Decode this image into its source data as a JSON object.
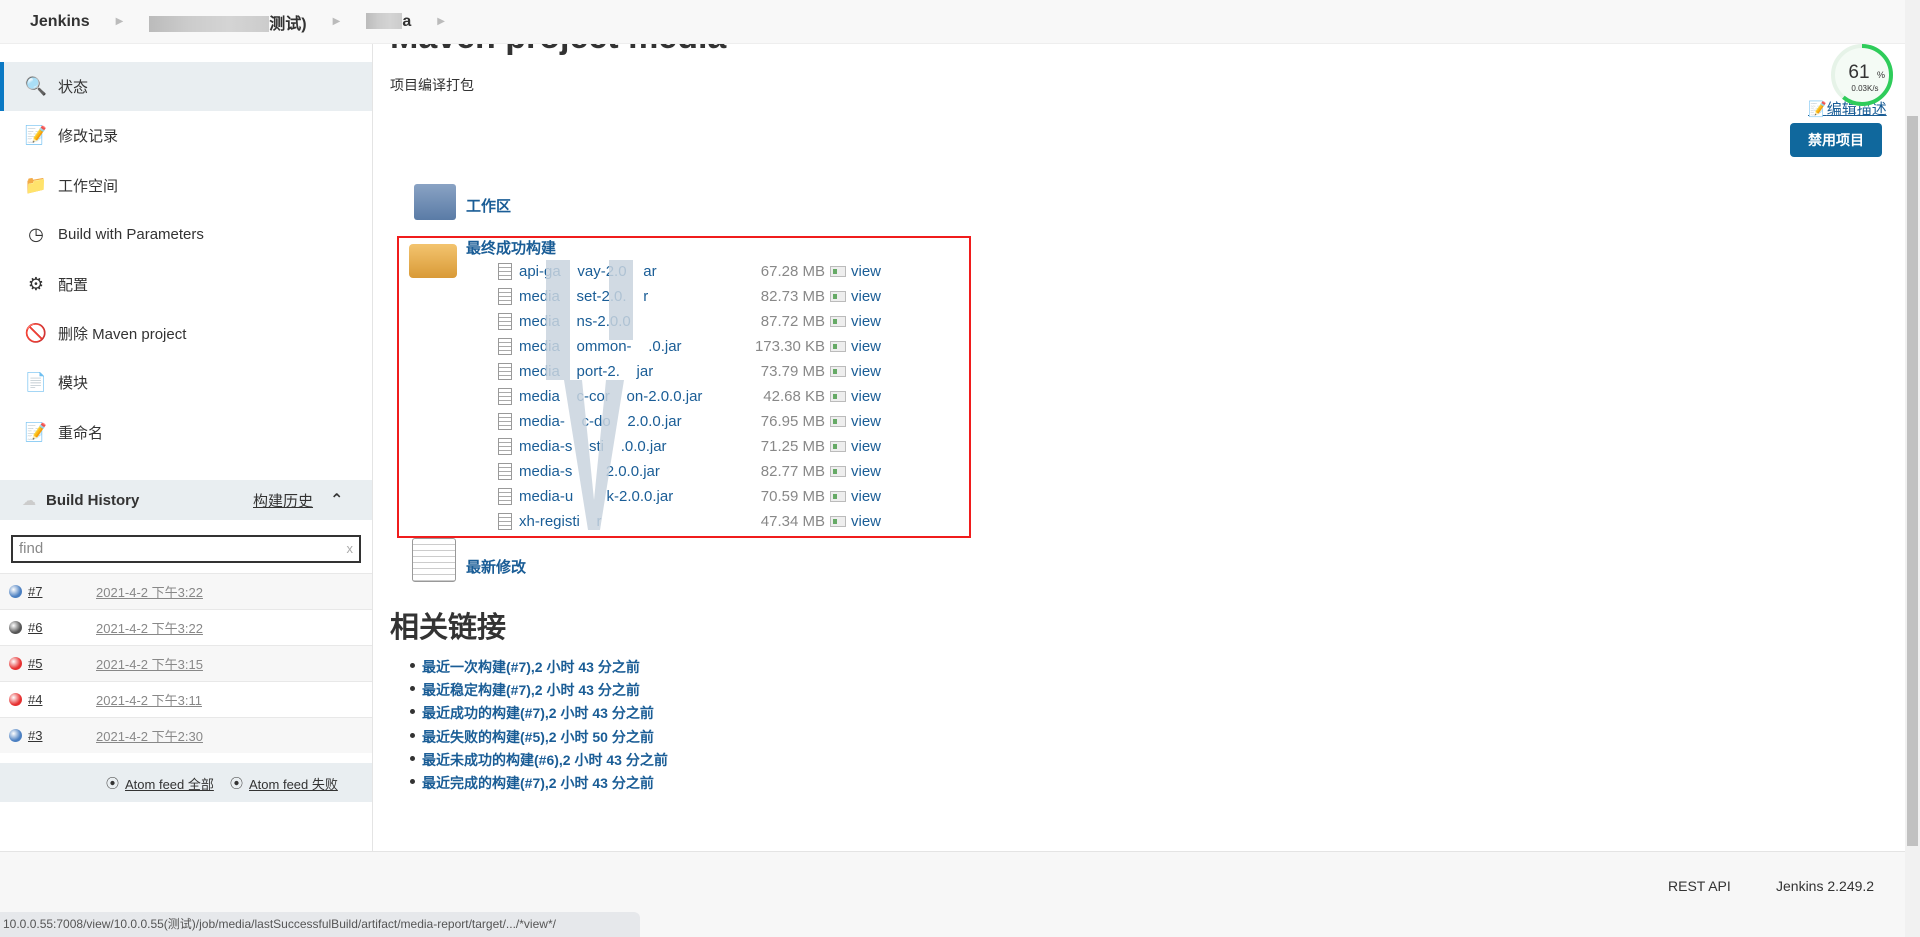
{
  "breadcrumb": {
    "root": "Jenkins",
    "view": "测试)",
    "job": "a"
  },
  "sidebar": {
    "items": [
      {
        "label": "状态",
        "icon": "magnifier-icon",
        "active": true
      },
      {
        "label": "修改记录",
        "icon": "notepad-icon"
      },
      {
        "label": "工作空间",
        "icon": "folder-icon"
      },
      {
        "label": "Build with Parameters",
        "icon": "clock-icon"
      },
      {
        "label": "配置",
        "icon": "gear-icon"
      },
      {
        "label": "删除 Maven project",
        "icon": "no-entry-icon"
      },
      {
        "label": "模块",
        "icon": "document-icon"
      },
      {
        "label": "重命名",
        "icon": "notepad-icon"
      }
    ]
  },
  "build_history": {
    "title": "Build History",
    "link": "构建历史",
    "find_placeholder": "find",
    "clear": "x",
    "builds": [
      {
        "num": "#7",
        "date": "2021-4-2 下午3:22",
        "status": "success",
        "color": "#4a7fc1"
      },
      {
        "num": "#6",
        "date": "2021-4-2 下午3:22",
        "status": "aborted",
        "color": "#555555"
      },
      {
        "num": "#5",
        "date": "2021-4-2 下午3:15",
        "status": "failed",
        "color": "#e63030"
      },
      {
        "num": "#4",
        "date": "2021-4-2 下午3:11",
        "status": "failed",
        "color": "#e63030"
      },
      {
        "num": "#3",
        "date": "2021-4-2 下午2:30",
        "status": "success",
        "color": "#4a7fc1"
      }
    ],
    "atom_all": "Atom feed 全部",
    "atom_fail": "Atom feed 失败"
  },
  "main": {
    "title": "Maven project media",
    "description": "项目编译打包",
    "edit_description": "编辑描述",
    "disable_button": "禁用项目",
    "workspace": "工作区",
    "last_success": "最终成功构建",
    "recent_changes": "最新修改",
    "artifacts": [
      {
        "name": "api-ga    vay-2.0    ar",
        "size": "67.28 MB",
        "view": "view"
      },
      {
        "name": "media    set-2.0.    r",
        "size": "82.73 MB",
        "view": "view"
      },
      {
        "name": "media    ns-2.0.0",
        "size": "87.72 MB",
        "view": "view"
      },
      {
        "name": "media    ommon-    .0.jar",
        "size": "173.30 KB",
        "view": "view"
      },
      {
        "name": "media    port-2.    jar",
        "size": "73.79 MB",
        "view": "view"
      },
      {
        "name": "media    c-cor    on-2.0.0.jar",
        "size": "42.68 KB",
        "view": "view"
      },
      {
        "name": "media-    c-do    2.0.0.jar",
        "size": "76.95 MB",
        "view": "view"
      },
      {
        "name": "media-s    sti    .0.0.jar",
        "size": "71.25 MB",
        "view": "view"
      },
      {
        "name": "media-s        2.0.0.jar",
        "size": "82.77 MB",
        "view": "view"
      },
      {
        "name": "media-u        k-2.0.0.jar",
        "size": "70.59 MB",
        "view": "view"
      },
      {
        "name": "xh-registi    r",
        "size": "47.34 MB",
        "view": "view"
      }
    ],
    "related_title": "相关链接",
    "related_links": [
      "最近一次构建(#7),2 小时 43 分之前",
      "最近稳定构建(#7),2 小时 43 分之前",
      "最近成功的构建(#7),2 小时 43 分之前",
      "最近失败的构建(#5),2 小时 50 分之前",
      "最近未成功的构建(#6),2 小时 43 分之前",
      "最近完成的构建(#7),2 小时 43 分之前"
    ]
  },
  "gauge": {
    "percent": 61,
    "percent_label": "61",
    "unit": "%",
    "speed": "0.03K/s",
    "color": "#2ecc5a"
  },
  "footer": {
    "rest_api": "REST API",
    "version": "Jenkins 2.249.2"
  },
  "status_bar": "10.0.0.55:7008/view/10.0.0.55(测试)/job/media/lastSuccessfulBuild/artifact/media-report/target/.../*view*/",
  "colors": {
    "link": "#1a5d96",
    "button": "#10689d",
    "highlight_box": "#f01c1c"
  }
}
